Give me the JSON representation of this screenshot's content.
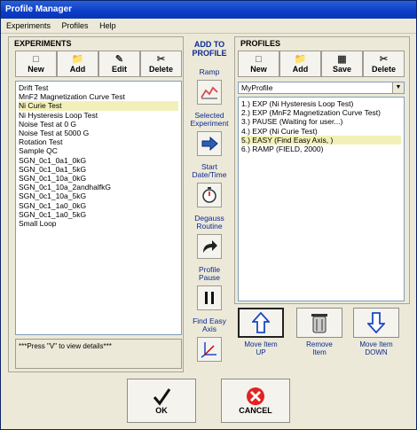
{
  "window": {
    "title": "Profile Manager"
  },
  "menu": [
    "Experiments",
    "Profiles",
    "Help"
  ],
  "experiments": {
    "heading": "EXPERIMENTS",
    "buttons": [
      "New",
      "Add",
      "Edit",
      "Delete"
    ],
    "items": [
      "Drift Test",
      "MnF2 Magnetization Curve Test",
      "Ni Curie Test",
      "Ni Hysteresis Loop Test",
      "Noise Test at 0 G",
      "Noise Test at 5000 G",
      "Rotation Test",
      "Sample QC",
      "SGN_0c1_0a1_0kG",
      "SGN_0c1_0a1_5kG",
      "SGN_0c1_10a_0kG",
      "SGN_0c1_10a_2andhalfkG",
      "SGN_0c1_10a_5kG",
      "SGN_0c1_1a0_0kG",
      "SGN_0c1_1a0_5kG",
      "Small Loop"
    ],
    "selected_index": 2,
    "note": "***Press \"V\" to view details***"
  },
  "add_to_profile": {
    "title": "ADD TO\nPROFILE",
    "items": [
      {
        "label": "Ramp",
        "icon": "ramp-icon"
      },
      {
        "label": "Selected\nExperiment",
        "icon": "arrow-right-icon"
      },
      {
        "label": "Start\nDate/Time",
        "icon": "stopwatch-icon"
      },
      {
        "label": "Degauss\nRoutine",
        "icon": "curved-arrow-icon"
      },
      {
        "label": "Profile\nPause",
        "icon": "pause-icon"
      },
      {
        "label": "Find Easy\nAxis",
        "icon": "axis-icon"
      }
    ]
  },
  "profiles": {
    "heading": "PROFILES",
    "buttons": [
      "New",
      "Add",
      "Save",
      "Delete"
    ],
    "current": "MyProfile",
    "items": [
      "1.) EXP (Ni Hysteresis Loop Test)",
      "2.) EXP (MnF2 Magnetization Curve Test)",
      "3.) PAUSE (Waiting for user...)",
      "4.) EXP (Ni Curie Test)",
      "5.) EASY (Find Easy Axis, )",
      "6.) RAMP (FIELD,  2000)"
    ],
    "selected_index": 4,
    "move_up": "Move Item\nUP",
    "remove": "Remove\nItem",
    "move_down": "Move Item\nDOWN"
  },
  "footer": {
    "ok": "OK",
    "cancel": "CANCEL"
  }
}
